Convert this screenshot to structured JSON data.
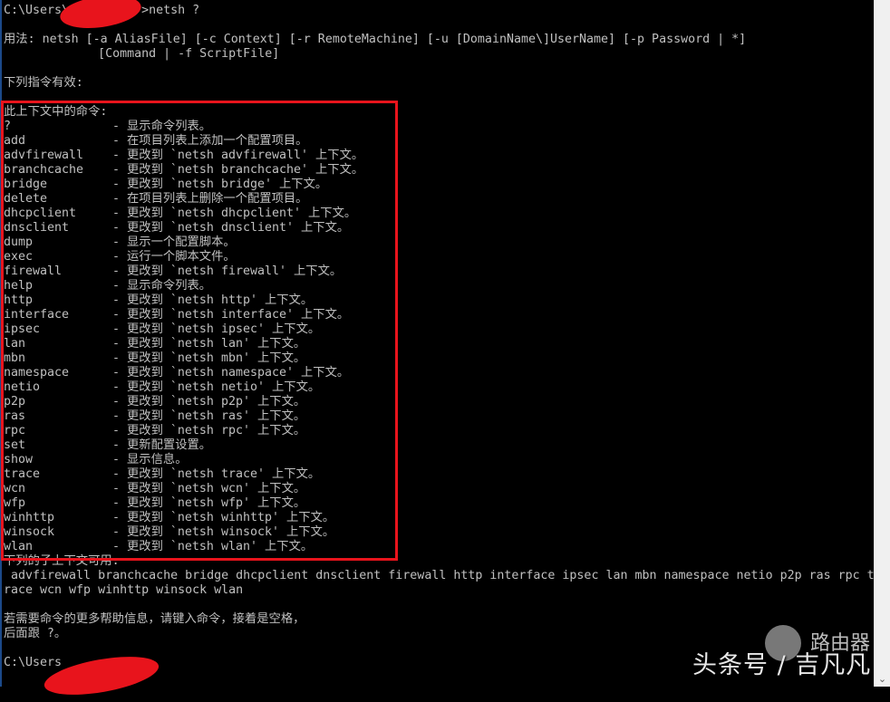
{
  "prompt_line": "C:\\Users\\          >netsh ?",
  "usage": [
    "用法: netsh [-a AliasFile] [-c Context] [-r RemoteMachine] [-u [DomainName\\]UserName] [-p Password | *]",
    "             [Command | -f ScriptFile]"
  ],
  "valid_commands_heading": "下列指令有效:",
  "context_commands_heading": "此上下文中的命令:",
  "commands": [
    {
      "name": "?",
      "desc": "- 显示命令列表。"
    },
    {
      "name": "add",
      "desc": "- 在项目列表上添加一个配置项目。"
    },
    {
      "name": "advfirewall",
      "desc": "- 更改到 `netsh advfirewall' 上下文。"
    },
    {
      "name": "branchcache",
      "desc": "- 更改到 `netsh branchcache' 上下文。"
    },
    {
      "name": "bridge",
      "desc": "- 更改到 `netsh bridge' 上下文。"
    },
    {
      "name": "delete",
      "desc": "- 在项目列表上删除一个配置项目。"
    },
    {
      "name": "dhcpclient",
      "desc": "- 更改到 `netsh dhcpclient' 上下文。"
    },
    {
      "name": "dnsclient",
      "desc": "- 更改到 `netsh dnsclient' 上下文。"
    },
    {
      "name": "dump",
      "desc": "- 显示一个配置脚本。"
    },
    {
      "name": "exec",
      "desc": "- 运行一个脚本文件。"
    },
    {
      "name": "firewall",
      "desc": "- 更改到 `netsh firewall' 上下文。"
    },
    {
      "name": "help",
      "desc": "- 显示命令列表。"
    },
    {
      "name": "http",
      "desc": "- 更改到 `netsh http' 上下文。"
    },
    {
      "name": "interface",
      "desc": "- 更改到 `netsh interface' 上下文。"
    },
    {
      "name": "ipsec",
      "desc": "- 更改到 `netsh ipsec' 上下文。"
    },
    {
      "name": "lan",
      "desc": "- 更改到 `netsh lan' 上下文。"
    },
    {
      "name": "mbn",
      "desc": "- 更改到 `netsh mbn' 上下文。"
    },
    {
      "name": "namespace",
      "desc": "- 更改到 `netsh namespace' 上下文。"
    },
    {
      "name": "netio",
      "desc": "- 更改到 `netsh netio' 上下文。"
    },
    {
      "name": "p2p",
      "desc": "- 更改到 `netsh p2p' 上下文。"
    },
    {
      "name": "ras",
      "desc": "- 更改到 `netsh ras' 上下文。"
    },
    {
      "name": "rpc",
      "desc": "- 更改到 `netsh rpc' 上下文。"
    },
    {
      "name": "set",
      "desc": "- 更新配置设置。"
    },
    {
      "name": "show",
      "desc": "- 显示信息。"
    },
    {
      "name": "trace",
      "desc": "- 更改到 `netsh trace' 上下文。"
    },
    {
      "name": "wcn",
      "desc": "- 更改到 `netsh wcn' 上下文。"
    },
    {
      "name": "wfp",
      "desc": "- 更改到 `netsh wfp' 上下文。"
    },
    {
      "name": "winhttp",
      "desc": "- 更改到 `netsh winhttp' 上下文。"
    },
    {
      "name": "winsock",
      "desc": "- 更改到 `netsh winsock' 上下文。"
    },
    {
      "name": "wlan",
      "desc": "- 更改到 `netsh wlan' 上下文。"
    }
  ],
  "subcontexts_heading": "下列的子上下文可用:",
  "subcontexts": [
    " advfirewall branchcache bridge dhcpclient dnsclient firewall http interface ipsec lan mbn namespace netio p2p ras rpc t",
    "race wcn wfp winhttp winsock wlan"
  ],
  "help_hint": [
    "若需要命令的更多帮助信息，请键入命令，接着是空格，",
    "后面跟 ?。"
  ],
  "final_prompt": "C:\\Users",
  "watermark": {
    "main": "头条号 / 吉凡凡",
    "brand": "路由器"
  },
  "colors": {
    "highlight_box": "#e8141c",
    "text": "#c0c0c0",
    "background": "#000000"
  }
}
